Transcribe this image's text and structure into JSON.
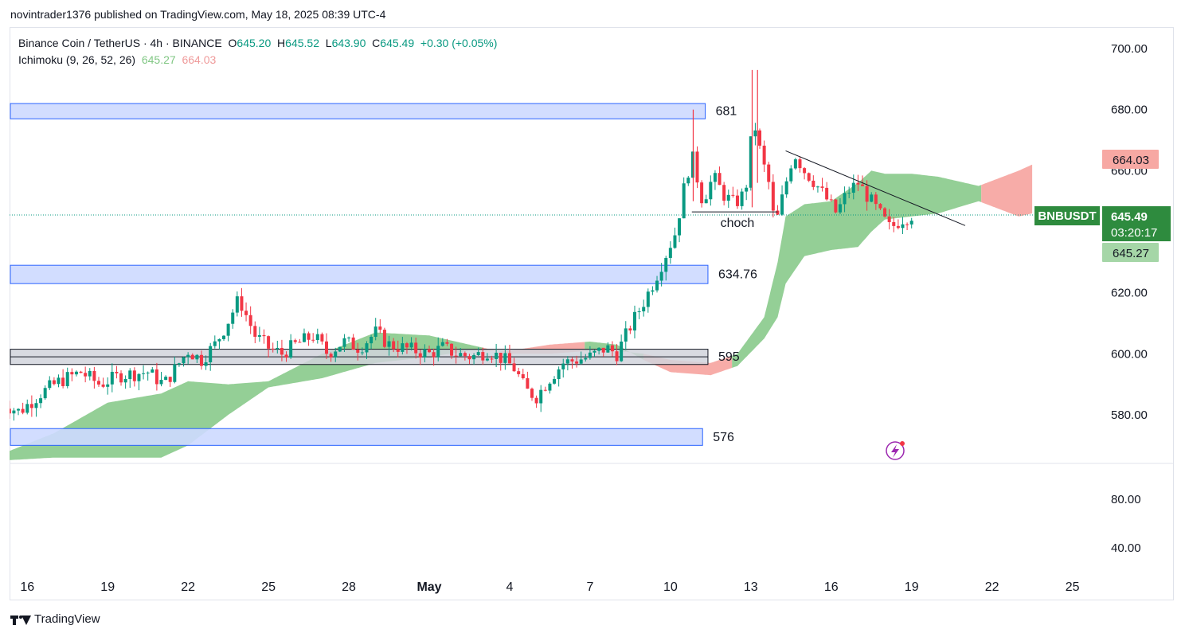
{
  "header": {
    "publisher_line": "novintrader1376 published on TradingView.com, May 18, 2025 08:39 UTC-4"
  },
  "legend": {
    "symbol": "Binance Coin / TetherUS · 4h · BINANCE",
    "open_label": "O",
    "open": "645.20",
    "high_label": "H",
    "high": "645.52",
    "low_label": "L",
    "low": "643.90",
    "close_label": "C",
    "close": "645.49",
    "change": "+0.30 (+0.05%)",
    "indicator": "Ichimoku (9, 26, 52, 26)",
    "ind_value1": "645.27",
    "ind_value2": "664.03"
  },
  "footer": {
    "brand": "TradingView"
  },
  "colors": {
    "up": "#089981",
    "down": "#f23645",
    "cloud_green": "#81c784",
    "cloud_red": "#f7a8a3",
    "zone_blue": "#cdd9ff",
    "zone_blue_border": "#2962ff",
    "zone_gray": "#d1d4dc"
  },
  "chart_data": {
    "type": "candlestick",
    "symbol": "BNBUSDT",
    "timeframe": "4h",
    "ylim": [
      565,
      703
    ],
    "y_ticks": [
      "700.00",
      "680.00",
      "660.00",
      "620.00",
      "600.00",
      "580.00"
    ],
    "x_ticks": [
      "16",
      "19",
      "22",
      "25",
      "28",
      "May",
      "4",
      "7",
      "10",
      "13",
      "16",
      "19",
      "22",
      "25"
    ],
    "x_tick_days": [
      -15,
      -12,
      -9,
      -6,
      -3,
      0,
      3,
      6,
      9,
      12,
      15,
      18,
      21,
      24
    ],
    "volume_pane": {
      "ylim": [
        20,
        100
      ],
      "ticks": [
        "80.00",
        "40.00"
      ]
    },
    "price_path": [
      [
        -16.0,
        584
      ],
      [
        -15.3,
        581
      ],
      [
        -14.5,
        587
      ],
      [
        -13.8,
        591
      ],
      [
        -13.0,
        594
      ],
      [
        -12.3,
        590
      ],
      [
        -11.5,
        593
      ],
      [
        -10.5,
        594
      ],
      [
        -9.9,
        590
      ],
      [
        -9.0,
        601
      ],
      [
        -8.5,
        598
      ],
      [
        -8.0,
        603
      ],
      [
        -7.6,
        609
      ],
      [
        -7.1,
        618
      ],
      [
        -6.8,
        612
      ],
      [
        -6.5,
        606
      ],
      [
        -6.0,
        602
      ],
      [
        -5.5,
        600
      ],
      [
        -5.0,
        603
      ],
      [
        -4.3,
        606
      ],
      [
        -3.8,
        600
      ],
      [
        -3.2,
        604
      ],
      [
        -2.6,
        602
      ],
      [
        -2.0,
        607
      ],
      [
        -1.5,
        603
      ],
      [
        -1.0,
        602
      ],
      [
        -0.5,
        601
      ],
      [
        0.0,
        600
      ],
      [
        0.5,
        602
      ],
      [
        1.0,
        600
      ],
      [
        1.6,
        599
      ],
      [
        2.2,
        601
      ],
      [
        2.8,
        598
      ],
      [
        3.2,
        595
      ],
      [
        3.6,
        588
      ],
      [
        4.0,
        586
      ],
      [
        4.5,
        592
      ],
      [
        5.0,
        597
      ],
      [
        5.5,
        598
      ],
      [
        6.0,
        599
      ],
      [
        6.6,
        602
      ],
      [
        7.0,
        600
      ],
      [
        7.5,
        609
      ],
      [
        8.0,
        617
      ],
      [
        8.4,
        624
      ],
      [
        8.8,
        632
      ],
      [
        9.2,
        640
      ],
      [
        9.5,
        654
      ],
      [
        9.8,
        665
      ],
      [
        10.2,
        650
      ],
      [
        10.6,
        658
      ],
      [
        11.0,
        652
      ],
      [
        11.4,
        649
      ],
      [
        11.8,
        653
      ],
      [
        12.1,
        677
      ],
      [
        12.4,
        664
      ],
      [
        12.7,
        655
      ],
      [
        12.9,
        641
      ],
      [
        13.2,
        652
      ],
      [
        13.6,
        666
      ],
      [
        14.0,
        660
      ],
      [
        14.4,
        656
      ],
      [
        14.8,
        651
      ],
      [
        15.2,
        646
      ],
      [
        15.6,
        653
      ],
      [
        16.0,
        656
      ],
      [
        16.4,
        651
      ],
      [
        16.8,
        646
      ],
      [
        17.2,
        641
      ],
      [
        17.6,
        644
      ],
      [
        18.0,
        645.49
      ]
    ],
    "wicks": [
      {
        "day": 12.05,
        "low": 648,
        "high": 693
      },
      {
        "day": 12.25,
        "low": 656,
        "high": 693
      },
      {
        "day": 9.85,
        "low": 650,
        "high": 680
      }
    ],
    "ichimoku": {
      "cloud_upper": [
        [
          -16.0,
          567
        ],
        [
          -14.0,
          574
        ],
        [
          -12.0,
          584
        ],
        [
          -10.0,
          587
        ],
        [
          -9.0,
          591
        ],
        [
          -7.5,
          590
        ],
        [
          -6.0,
          591
        ],
        [
          -4.0,
          600
        ],
        [
          -2.0,
          607
        ],
        [
          0.0,
          606
        ],
        [
          1.5,
          603
        ],
        [
          3.0,
          600
        ],
        [
          4.5,
          600
        ],
        [
          6.0,
          601
        ],
        [
          7.0,
          601
        ],
        [
          8.0,
          600
        ],
        [
          9.0,
          598
        ],
        [
          10.5,
          597
        ],
        [
          11.5,
          600
        ],
        [
          12.5,
          612
        ],
        [
          13.0,
          630
        ],
        [
          13.3,
          645
        ],
        [
          14.0,
          649
        ],
        [
          15.0,
          650
        ],
        [
          16.0,
          656
        ],
        [
          16.5,
          660
        ],
        [
          17.0,
          659
        ],
        [
          18.0,
          659
        ],
        [
          19.0,
          658
        ],
        [
          20.5,
          655
        ],
        [
          22.0,
          660
        ],
        [
          22.5,
          662
        ]
      ],
      "cloud_lower": [
        [
          -16.0,
          565
        ],
        [
          -14.0,
          566
        ],
        [
          -12.0,
          566
        ],
        [
          -10.0,
          566
        ],
        [
          -9.0,
          570
        ],
        [
          -7.5,
          580
        ],
        [
          -6.0,
          589
        ],
        [
          -4.0,
          592
        ],
        [
          -2.0,
          597
        ],
        [
          0.0,
          599
        ],
        [
          1.5,
          601
        ],
        [
          3.0,
          601
        ],
        [
          4.5,
          603
        ],
        [
          6.0,
          604
        ],
        [
          7.0,
          603
        ],
        [
          8.0,
          598
        ],
        [
          9.0,
          594
        ],
        [
          10.5,
          593
        ],
        [
          11.5,
          596
        ],
        [
          12.5,
          605
        ],
        [
          13.0,
          612
        ],
        [
          13.3,
          623
        ],
        [
          14.0,
          632
        ],
        [
          15.0,
          634
        ],
        [
          16.0,
          635
        ],
        [
          16.5,
          640
        ],
        [
          17.0,
          644
        ],
        [
          18.0,
          645
        ],
        [
          19.0,
          646
        ],
        [
          20.5,
          650
        ],
        [
          22.0,
          645
        ],
        [
          22.5,
          646
        ]
      ],
      "bearish_spans": [
        [
          2.0,
          5.8
        ],
        [
          8.0,
          11.3
        ],
        [
          20.6,
          22.5
        ]
      ]
    },
    "zones": [
      {
        "low": 677,
        "high": 682,
        "label": "681",
        "kind": "resistance",
        "end_day": 10.3
      },
      {
        "low": 623,
        "high": 629,
        "label": "634.76",
        "kind": "support",
        "end_day": 10.4
      },
      {
        "low": 596.5,
        "high": 601.5,
        "label": "595",
        "kind": "range",
        "end_day": 10.4
      },
      {
        "low": 570,
        "high": 575.5,
        "label": "576",
        "kind": "support",
        "end_day": 10.2
      }
    ],
    "annotations": {
      "choch": {
        "label": "choch",
        "price": 646.5,
        "from_day": 9.8,
        "to_day": 13.0
      },
      "trendline": {
        "from": [
          13.3,
          666.5
        ],
        "to": [
          20.0,
          642.0
        ]
      }
    },
    "last_price_line": 645.49,
    "price_labels": [
      {
        "text": "664.03",
        "kind": "senkou-b"
      },
      {
        "text": "BNBUSDT",
        "kind": "symbol"
      },
      {
        "text": "645.49",
        "kind": "last"
      },
      {
        "text": "03:20:17",
        "kind": "countdown"
      },
      {
        "text": "645.27",
        "kind": "senkou-a"
      }
    ]
  }
}
